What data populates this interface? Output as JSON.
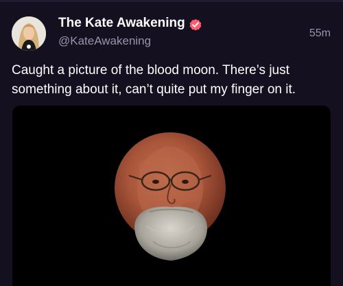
{
  "post": {
    "display_name": "The Kate Awakening",
    "handle": "@KateAwakening",
    "timestamp": "55m",
    "text": "Caught a picture of the blood moon. There’s just something about it, can’t quite put my finger on it.",
    "verified_icon": "verified-badge-icon",
    "avatar_icon": "avatar",
    "media_description_icon": "blood-moon-face-image"
  },
  "colors": {
    "background": "#14101f",
    "secondary_text": "#9a93ad",
    "verified_badge": "#ff5a6e",
    "moon": "#b05a3c"
  }
}
